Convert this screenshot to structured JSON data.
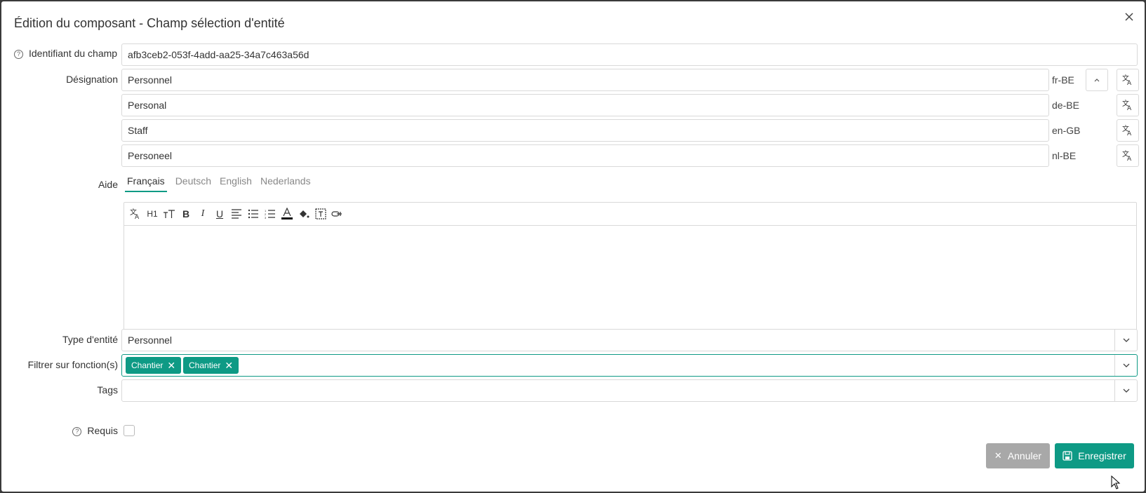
{
  "dialog": {
    "title": "Édition du composant - Champ sélection d'entité",
    "close_icon": "close-icon"
  },
  "identifier": {
    "label": "Identifiant du champ",
    "value": "afb3ceb2-053f-4add-aa25-34a7c463a56d"
  },
  "designation": {
    "label": "Désignation",
    "rows": [
      {
        "value": "Personnel",
        "lang": "fr-BE"
      },
      {
        "value": "Personal",
        "lang": "de-BE"
      },
      {
        "value": "Staff",
        "lang": "en-GB"
      },
      {
        "value": "Personeel",
        "lang": "nl-BE"
      }
    ]
  },
  "aide": {
    "label": "Aide",
    "tabs": [
      "Français",
      "Deutsch",
      "English",
      "Nederlands"
    ],
    "active_tab": "Français",
    "toolbar": {
      "h1": "H1"
    }
  },
  "entity_type": {
    "label": "Type d'entité",
    "value": "Personnel"
  },
  "filter": {
    "label": "Filtrer sur fonction(s)",
    "chips": [
      "Chantier",
      "Chantier"
    ]
  },
  "tags": {
    "label": "Tags",
    "value": ""
  },
  "required": {
    "label": "Requis",
    "checked": false
  },
  "buttons": {
    "cancel": "Annuler",
    "save": "Enregistrer"
  },
  "colors": {
    "accent": "#0e9a85",
    "cancel_bg": "#a8a8a8"
  }
}
